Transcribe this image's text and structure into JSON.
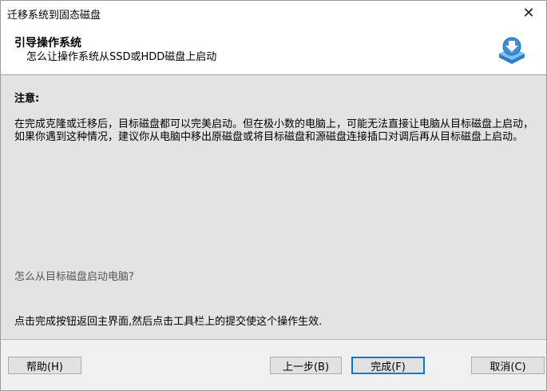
{
  "window": {
    "title": "迁移系统到固态磁盘",
    "close_glyph": "✕"
  },
  "header": {
    "title": "引导操作系统",
    "subtitle": "怎么让操作系统从SSD或HDD磁盘上启动"
  },
  "content": {
    "note_title": "注意:",
    "note_body": "在完成克隆或迁移后，目标磁盘都可以完美启动。但在极小数的电脑上，可能无法直接让电脑从目标磁盘上启动，如果你遇到这种情况，建议你从电脑中移出原磁盘或将目标磁盘和源磁盘连接插口对调后再从目标磁盘上启动。",
    "help_link": "怎么从目标磁盘启动电脑?",
    "instruction": "点击完成按钮返回主界面,然后点击工具栏上的提交使这个操作生效."
  },
  "buttons": {
    "help": "帮助(H)",
    "prev": "上一步(B)",
    "finish": "完成(F)",
    "cancel": "取消(C)"
  },
  "colors": {
    "content_bg": "#e3e3e3",
    "accent": "#0078d7",
    "icon_blue": "#3a8fd6"
  }
}
